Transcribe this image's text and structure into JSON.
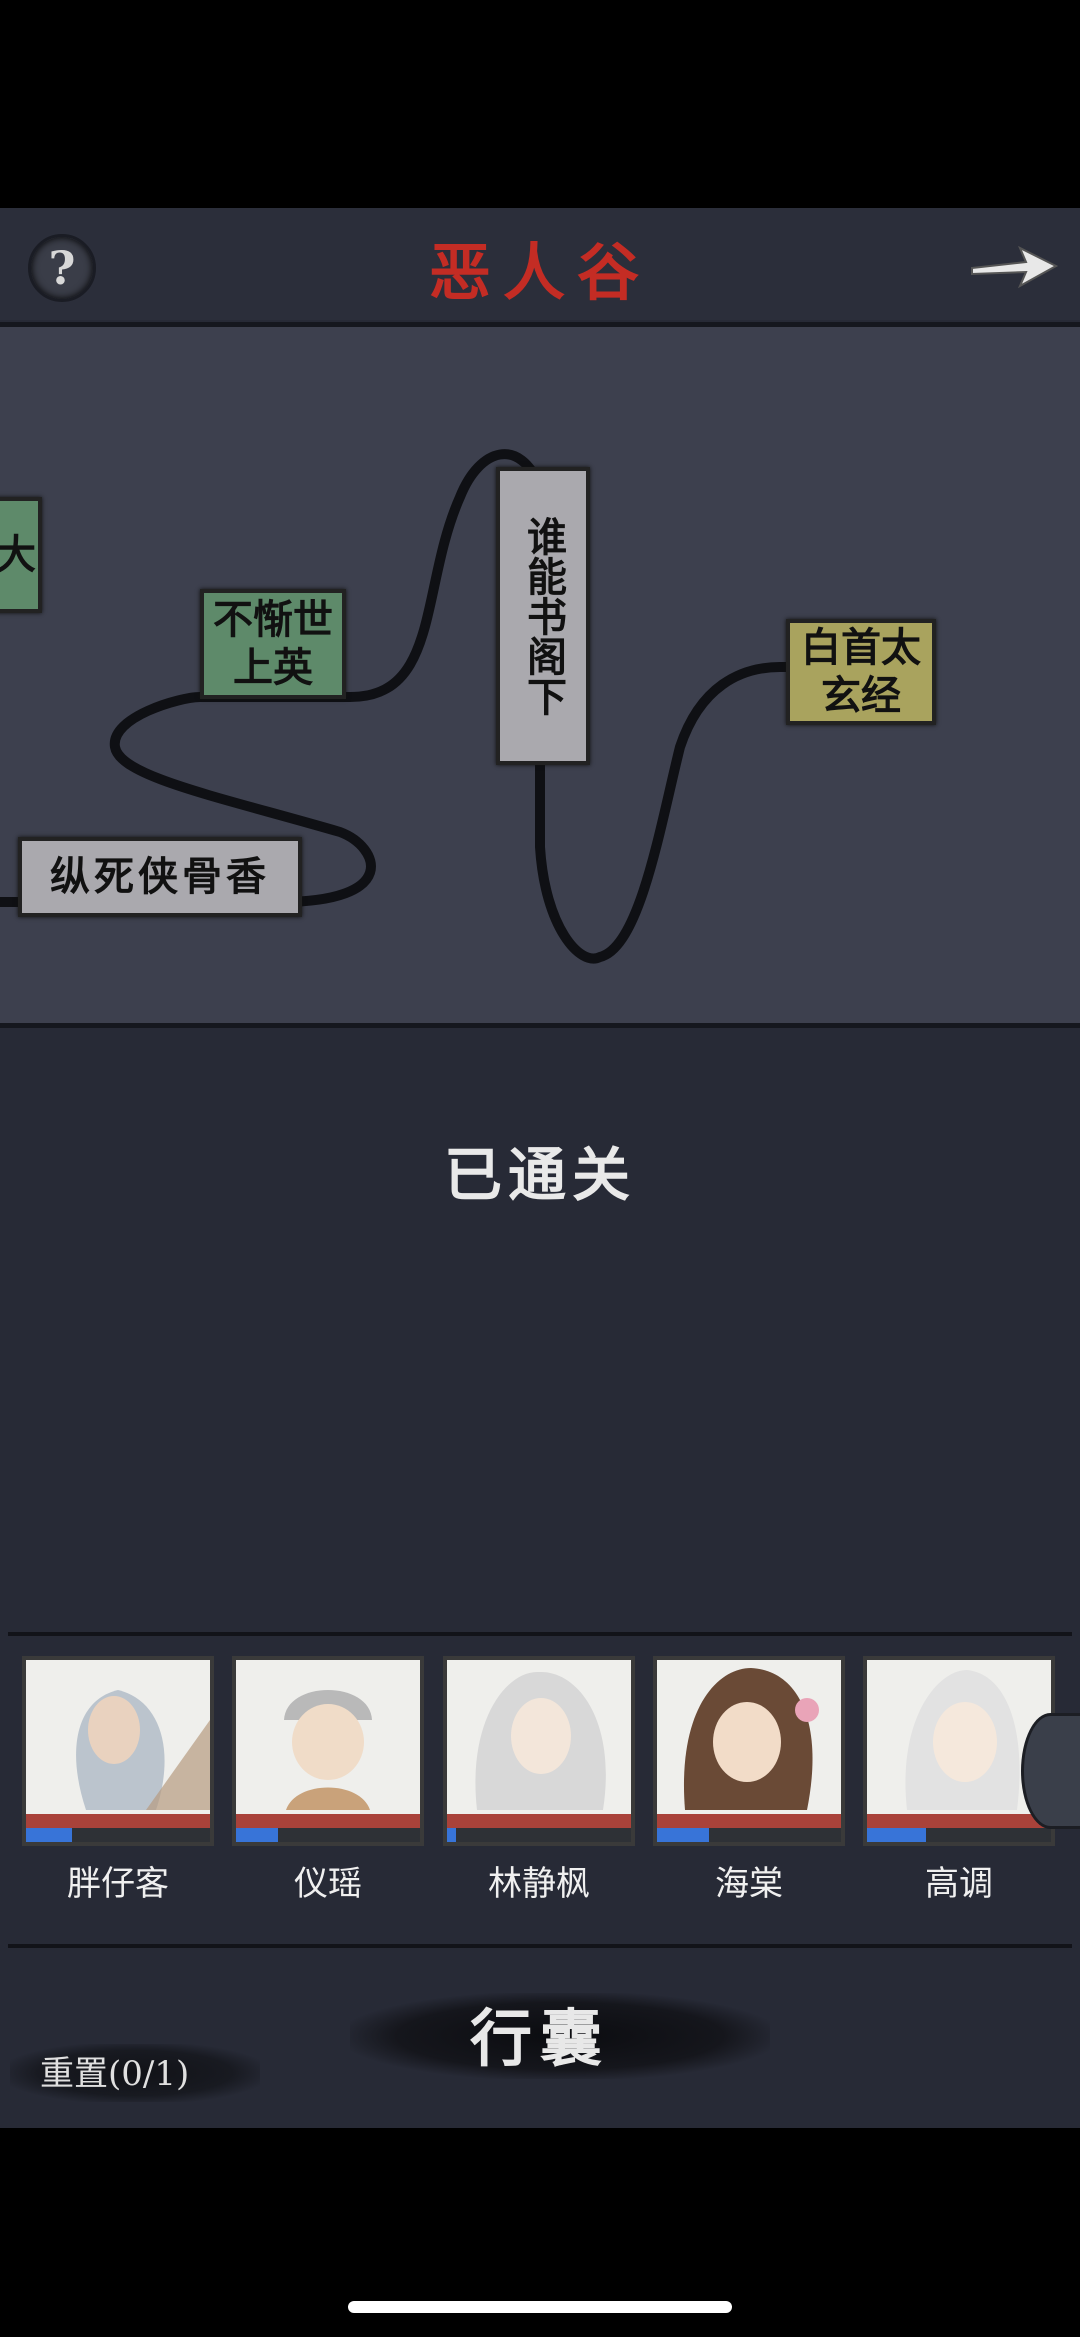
{
  "header": {
    "title": "恶人谷",
    "help_glyph": "?",
    "next_icon": "arrow-right-icon"
  },
  "map": {
    "nodes": [
      {
        "text": "大",
        "color": "#5e8a6a"
      },
      {
        "text": "不惭世上英",
        "color": "#5e8a6a"
      },
      {
        "text": "谁能书阁下",
        "color": "#aaa9ae"
      },
      {
        "text": "白首太玄经",
        "color": "#a9a35e"
      },
      {
        "text": "纵死侠骨香",
        "color": "#aaa9ae"
      }
    ]
  },
  "status": "已通关",
  "party": [
    {
      "name": "胖仔客",
      "hp": 1.0,
      "mp": 0.25
    },
    {
      "name": "仪瑶",
      "hp": 1.0,
      "mp": 0.23
    },
    {
      "name": "林静枫",
      "hp": 1.0,
      "mp": 0.05
    },
    {
      "name": "海棠",
      "hp": 1.0,
      "mp": 0.28
    },
    {
      "name": "高调",
      "hp": 1.0,
      "mp": 0.32
    }
  ],
  "bag_label": "行囊",
  "reset_label": "重置(0/1)",
  "colors": {
    "title": "#c42c24",
    "hp": "#a9423a",
    "mp": "#3874d8"
  }
}
